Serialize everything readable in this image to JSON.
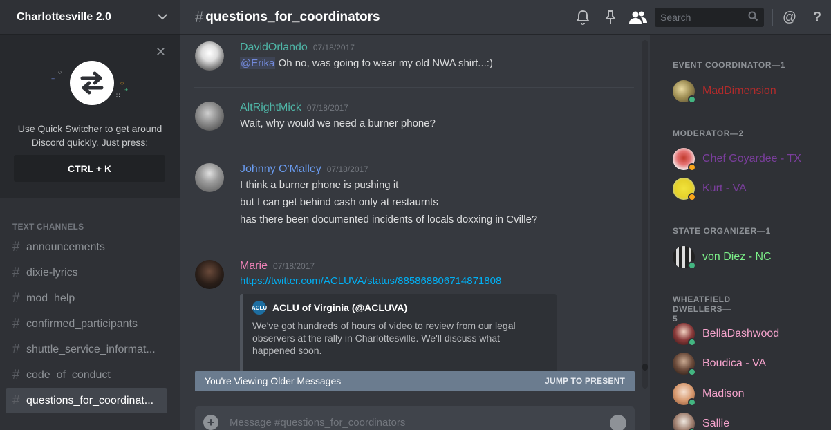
{
  "guild": {
    "name": "Charlottesville 2.0"
  },
  "quick_switcher": {
    "hint": "Use Quick Switcher to get around Discord quickly. Just press:",
    "shortcut": "CTRL + K"
  },
  "sidebar": {
    "section_title": "TEXT CHANNELS",
    "channels": [
      {
        "name": "announcements"
      },
      {
        "name": "dixie-lyrics"
      },
      {
        "name": "mod_help"
      },
      {
        "name": "confirmed_participants"
      },
      {
        "name": "shuttle_service_informat..."
      },
      {
        "name": "code_of_conduct"
      },
      {
        "name": "questions_for_coordinat..."
      }
    ],
    "selected_index": 6
  },
  "header": {
    "channel_name": "questions_for_coordinators",
    "search_placeholder": "Search"
  },
  "messages": [
    {
      "author": "DavidOrlando",
      "color": "#4fb6a7",
      "timestamp": "07/18/2017",
      "mention": "@Erika",
      "lines": [
        "Oh no, was going to wear my old NWA shirt...:)"
      ]
    },
    {
      "author": "AltRightMick",
      "color": "#4fb6a7",
      "timestamp": "07/18/2017",
      "lines": [
        "Wait, why would we need a burner phone?"
      ]
    },
    {
      "author": "Johnny O'Malley",
      "color": "#6a9cf0",
      "timestamp": "07/18/2017",
      "lines": [
        "I think a burner phone is pushing it",
        "but I can get behind cash only at restaurnts",
        "has there been documented incidents of locals doxxing in Cville?"
      ]
    },
    {
      "author": "Marie",
      "color": "#f083b8",
      "timestamp": "07/18/2017",
      "link": "https://twitter.com/ACLUVA/status/885868806714871808",
      "embed": {
        "title": "ACLU of Virginia (@ACLUVA)",
        "description": "We've got hundreds of hours of video to review from our legal observers at the rally in Charlottesville. We'll discuss what happened soon."
      }
    }
  ],
  "older_bar": {
    "text": "You're Viewing Older Messages",
    "jump": "JUMP TO PRESENT"
  },
  "composer": {
    "placeholder": "Message #questions_for_coordinators"
  },
  "members": {
    "roles": [
      {
        "title": "EVENT COORDINATOR—1",
        "members": [
          {
            "name": "MadDimension",
            "color": "#b12b2b",
            "status": "#43b581"
          }
        ]
      },
      {
        "title": "MODERATOR—2",
        "members": [
          {
            "name": "Chef Goyardee - TX",
            "color": "#7a3e9c",
            "status": "#faa61a"
          },
          {
            "name": "Kurt - VA",
            "color": "#7a3e9c",
            "status": "#faa61a"
          }
        ]
      },
      {
        "title": "STATE ORGANIZER—1",
        "members": [
          {
            "name": "von Diez - NC",
            "color": "#7cf089",
            "status": "#43b581"
          }
        ]
      },
      {
        "title": "WHEATFIELD DWELLERS—5",
        "members": [
          {
            "name": "BellaDashwood",
            "color": "#f5a3cc",
            "status": "#43b581"
          },
          {
            "name": "Boudica - VA",
            "color": "#f5a3cc",
            "status": "#43b581"
          },
          {
            "name": "Madison",
            "color": "#f5a3cc",
            "status": "#43b581"
          },
          {
            "name": "Sallie",
            "color": "#f5a3cc",
            "status": "#43b581"
          }
        ]
      }
    ]
  },
  "icons": [
    "chevron-down-icon",
    "close-icon",
    "bell-icon",
    "pin-icon",
    "members-icon",
    "search-icon",
    "mention-icon",
    "help-icon",
    "plus-icon",
    "emoji-icon"
  ]
}
